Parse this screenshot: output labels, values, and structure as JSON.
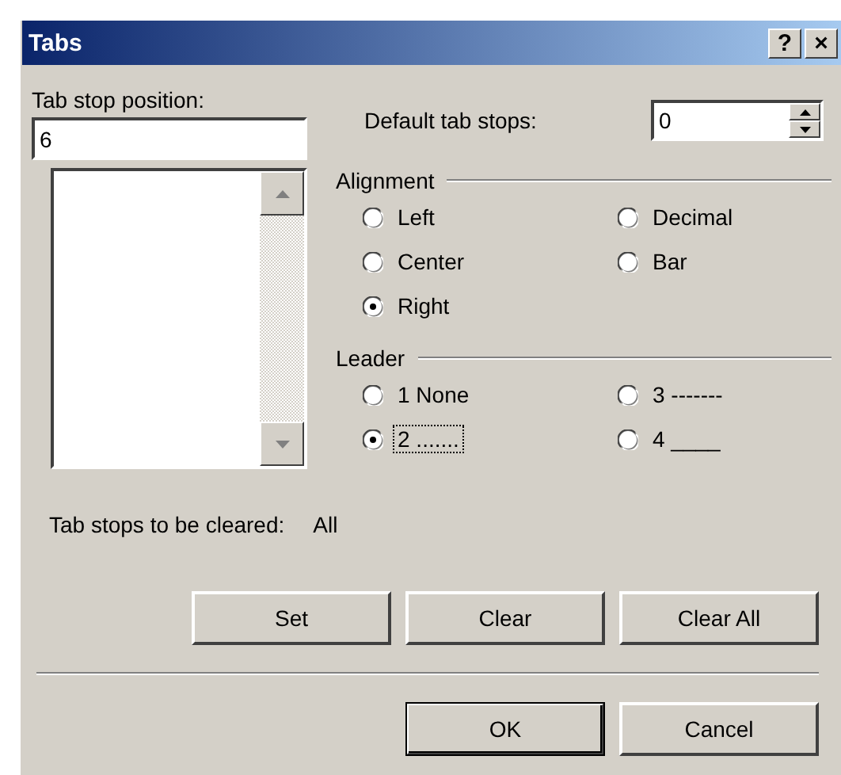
{
  "window": {
    "title": "Tabs",
    "help_button": "?",
    "close_button": "×"
  },
  "tab_stop_position": {
    "label": "Tab stop position:",
    "value": "6"
  },
  "default_tab_stops": {
    "label": "Default tab stops:",
    "value": "0"
  },
  "alignment": {
    "label": "Alignment",
    "options": [
      {
        "label": "Left",
        "selected": false
      },
      {
        "label": "Decimal",
        "selected": false
      },
      {
        "label": "Center",
        "selected": false
      },
      {
        "label": "Bar",
        "selected": false
      },
      {
        "label": "Right",
        "selected": true
      }
    ]
  },
  "leader": {
    "label": "Leader",
    "options": [
      {
        "label": "1 None",
        "selected": false,
        "focused": false
      },
      {
        "label": "3 -------",
        "selected": false,
        "focused": false
      },
      {
        "label": "2 .......",
        "selected": true,
        "focused": true
      },
      {
        "label": "4 ____",
        "selected": false,
        "focused": false
      }
    ]
  },
  "tab_stops_to_be_cleared": {
    "label": "Tab stops to be cleared:",
    "value": "All"
  },
  "action_buttons": [
    {
      "label": "Set"
    },
    {
      "label": "Clear"
    },
    {
      "label": "Clear All"
    }
  ],
  "dialog_buttons": [
    {
      "label": "OK",
      "default": true
    },
    {
      "label": "Cancel",
      "default": false
    }
  ]
}
